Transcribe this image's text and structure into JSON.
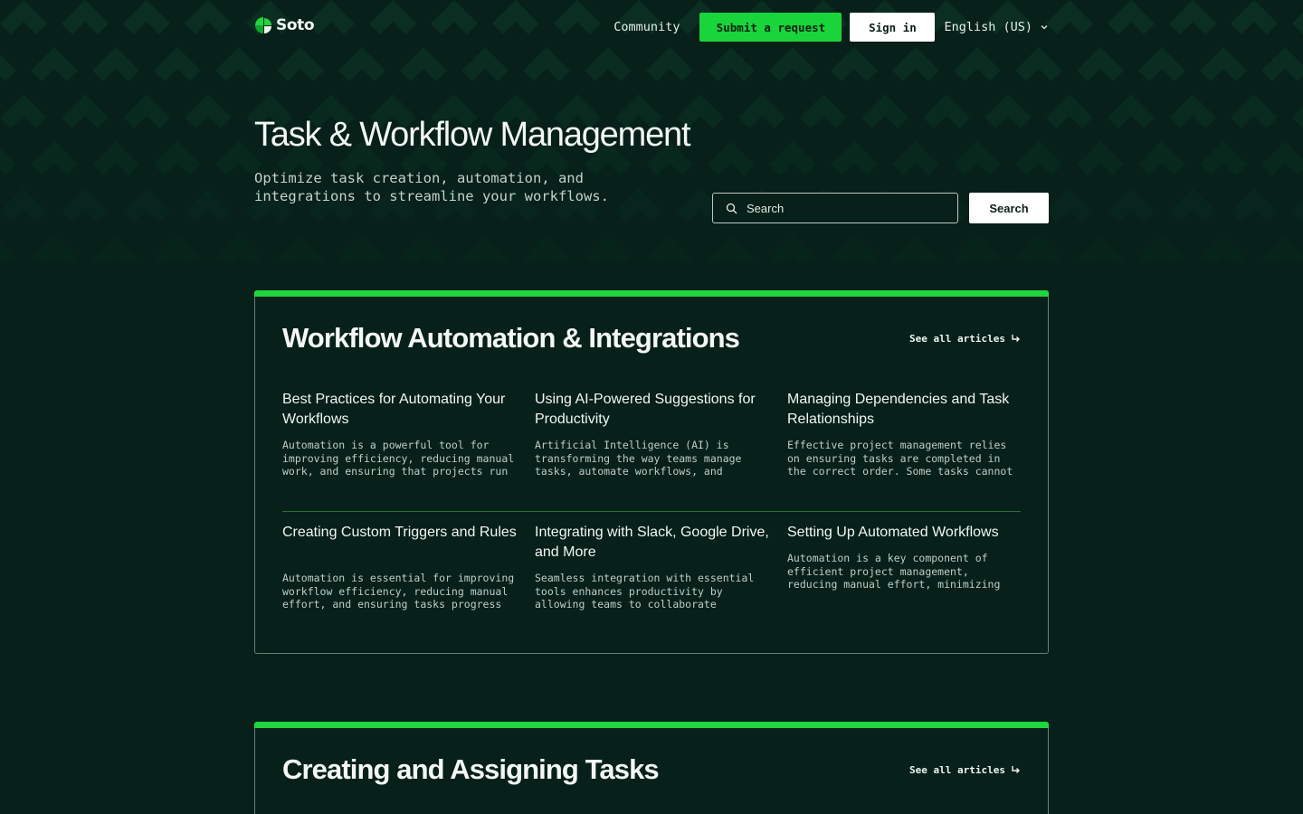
{
  "header": {
    "logo_text": "Soto",
    "community": "Community",
    "submit_request": "Submit a request",
    "sign_in": "Sign in",
    "language": "English (US)"
  },
  "hero": {
    "title": "Task & Workflow Management",
    "subtitle": "Optimize task creation, automation, and integrations to streamline your workflows.",
    "search_placeholder": "Search",
    "search_button": "Search"
  },
  "sections": [
    {
      "title": "Workflow Automation & Integrations",
      "see_all": "See all articles",
      "articles": [
        {
          "title": "Best Practices for Automating Your Workflows",
          "excerpt": "Automation is a powerful tool for improving efficiency, reducing manual work, and ensuring that projects run"
        },
        {
          "title": "Using AI-Powered Suggestions for Productivity",
          "excerpt": "Artificial Intelligence (AI) is transforming the way teams manage tasks, automate workflows, and"
        },
        {
          "title": "Managing Dependencies and Task Relationships",
          "excerpt": "Effective project management relies on ensuring tasks are completed in the correct order. Some tasks cannot"
        },
        {
          "title": "Creating Custom Triggers and Rules",
          "excerpt": "Automation is essential for improving workflow efficiency, reducing manual effort, and ensuring tasks progress"
        },
        {
          "title": "Integrating with Slack, Google Drive, and More",
          "excerpt": "Seamless integration with essential tools enhances productivity by allowing teams to collaborate"
        },
        {
          "title": "Setting Up Automated Workflows",
          "excerpt": "Automation is a key component of efficient project management, reducing manual effort, minimizing"
        }
      ]
    },
    {
      "title": "Creating and Assigning Tasks",
      "see_all": "See all articles"
    }
  ],
  "colors": {
    "background": "#072019",
    "accent": "#1fd63e",
    "pattern": "#0e3a2a"
  },
  "icons": [
    "soto-logo-icon",
    "chevron-down-icon",
    "search-icon",
    "arrow-right-icon"
  ]
}
